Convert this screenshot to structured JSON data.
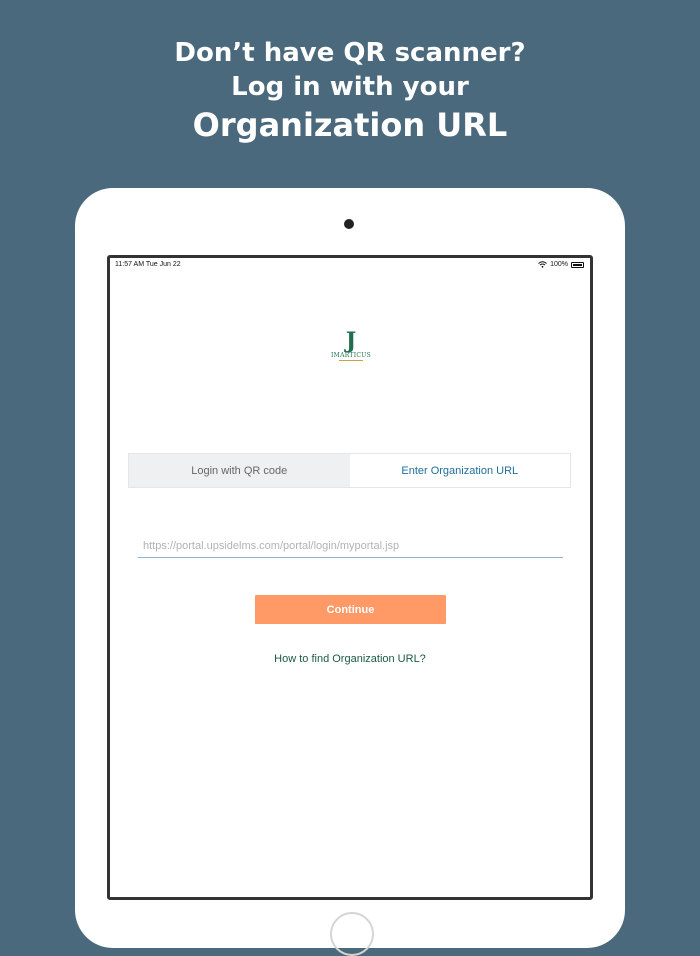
{
  "headline": {
    "line1": "Don’t have QR scanner?",
    "line2": "Log in with your",
    "line3": "Organization URL"
  },
  "statusbar": {
    "time": "11:57 AM   Tue Jun 22",
    "battery": "100%"
  },
  "logo": {
    "mark": "J",
    "text": "IMARTICUS"
  },
  "tabs": {
    "qr_label": "Login with QR code",
    "url_label": "Enter Organization URL",
    "selected": "Enter Organization URL"
  },
  "form": {
    "url_placeholder": "https://portal.upsidelms.com/portal/login/myportal.jsp",
    "url_value": "",
    "continue_label": "Continue",
    "help_link": "How to find Organization URL?"
  },
  "colors": {
    "background": "#4a697c",
    "accent_button": "#ff9966",
    "tab_active_text": "#1f6e9c",
    "link": "#1c5a46",
    "logo": "#1f6e4e"
  },
  "icons": [
    "wifi-icon",
    "battery-icon"
  ]
}
